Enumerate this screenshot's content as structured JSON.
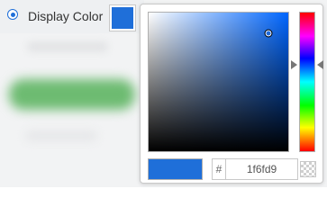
{
  "setting": {
    "label": "Display Color",
    "selected": true
  },
  "color": {
    "value": "#1f6fd9",
    "hex_text": "1f6fd9",
    "hash_symbol": "#",
    "hue_color": "#0066ff",
    "saturation": 0.86,
    "brightness": 0.85,
    "hue_fraction": 0.38
  },
  "icons": {
    "radio": "radio-selected-icon",
    "transparent_toggle": "checkerboard-transparent-icon",
    "hue_arrows": "triangle-pointer-icon"
  }
}
